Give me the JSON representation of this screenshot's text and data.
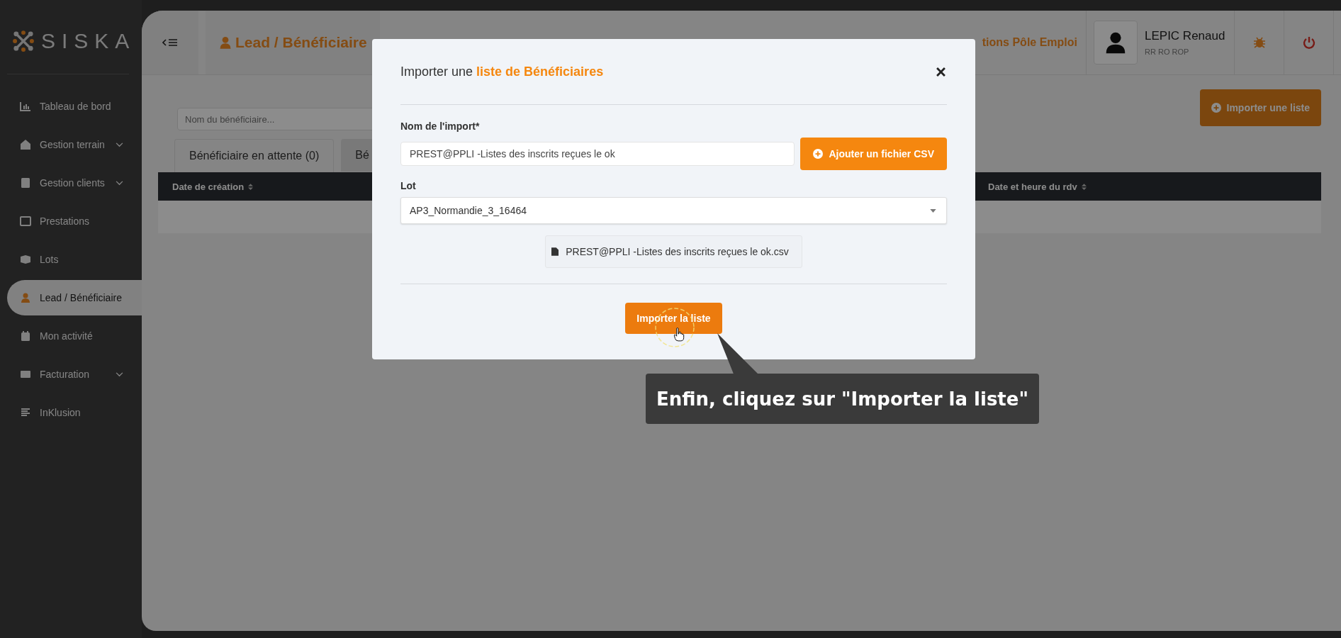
{
  "sidebar": {
    "logo": "SISKA",
    "items": [
      {
        "kind": "chart",
        "label": "Tableau de bord",
        "expandable": false,
        "selected": false
      },
      {
        "kind": "house",
        "label": "Gestion terrain",
        "expandable": true,
        "selected": false
      },
      {
        "kind": "contact",
        "label": "Gestion clients",
        "expandable": true,
        "selected": false
      },
      {
        "kind": "window",
        "label": "Prestations",
        "expandable": false,
        "selected": false
      },
      {
        "kind": "box",
        "label": "Lots",
        "expandable": false,
        "selected": false
      },
      {
        "kind": "person",
        "label": "Lead / Bénéficiaire",
        "expandable": false,
        "selected": true
      },
      {
        "kind": "calendar",
        "label": "Mon activité",
        "expandable": false,
        "selected": false
      },
      {
        "kind": "bill",
        "label": "Facturation",
        "expandable": true,
        "selected": false
      },
      {
        "kind": "lines",
        "label": "InKlusion",
        "expandable": false,
        "selected": false
      }
    ]
  },
  "header": {
    "title": "Lead / Bénéficiaire",
    "context": "tions Pôle Emploi",
    "user": {
      "name": "LEPIC Renaud",
      "role": "RR RO ROP"
    }
  },
  "toolbar": {
    "search": {
      "placeholder": "Nom du bénéficiaire..."
    },
    "import_button": "Importer une liste"
  },
  "tabs": [
    {
      "label": "Bénéficiaire en attente (0)",
      "selected": true
    },
    {
      "label": "Bé",
      "selected": false
    }
  ],
  "table": {
    "columns": [
      {
        "label": "Date de création",
        "sortable": true
      },
      {
        "label": "Date et heure du rdv",
        "sortable": true
      }
    ]
  },
  "modal": {
    "title": "Importer une",
    "title_highlight": "liste de Bénéficiaires",
    "fields": [
      {
        "kind": "text",
        "label": "Nom de l'import*",
        "value": "PREST@PPLI -Listes des inscrits reçues le ok"
      },
      {
        "kind": "select",
        "label": "Lot",
        "value": "AP3_Normandie_3_16464"
      }
    ],
    "add_file_button": "Ajouter un fichier CSV",
    "file": "PREST@PPLI -Listes des inscrits reçues le ok.csv",
    "submit_button": "Importer la liste"
  },
  "tooltip": "Enfin, cliquez sur \"Importer la liste\""
}
